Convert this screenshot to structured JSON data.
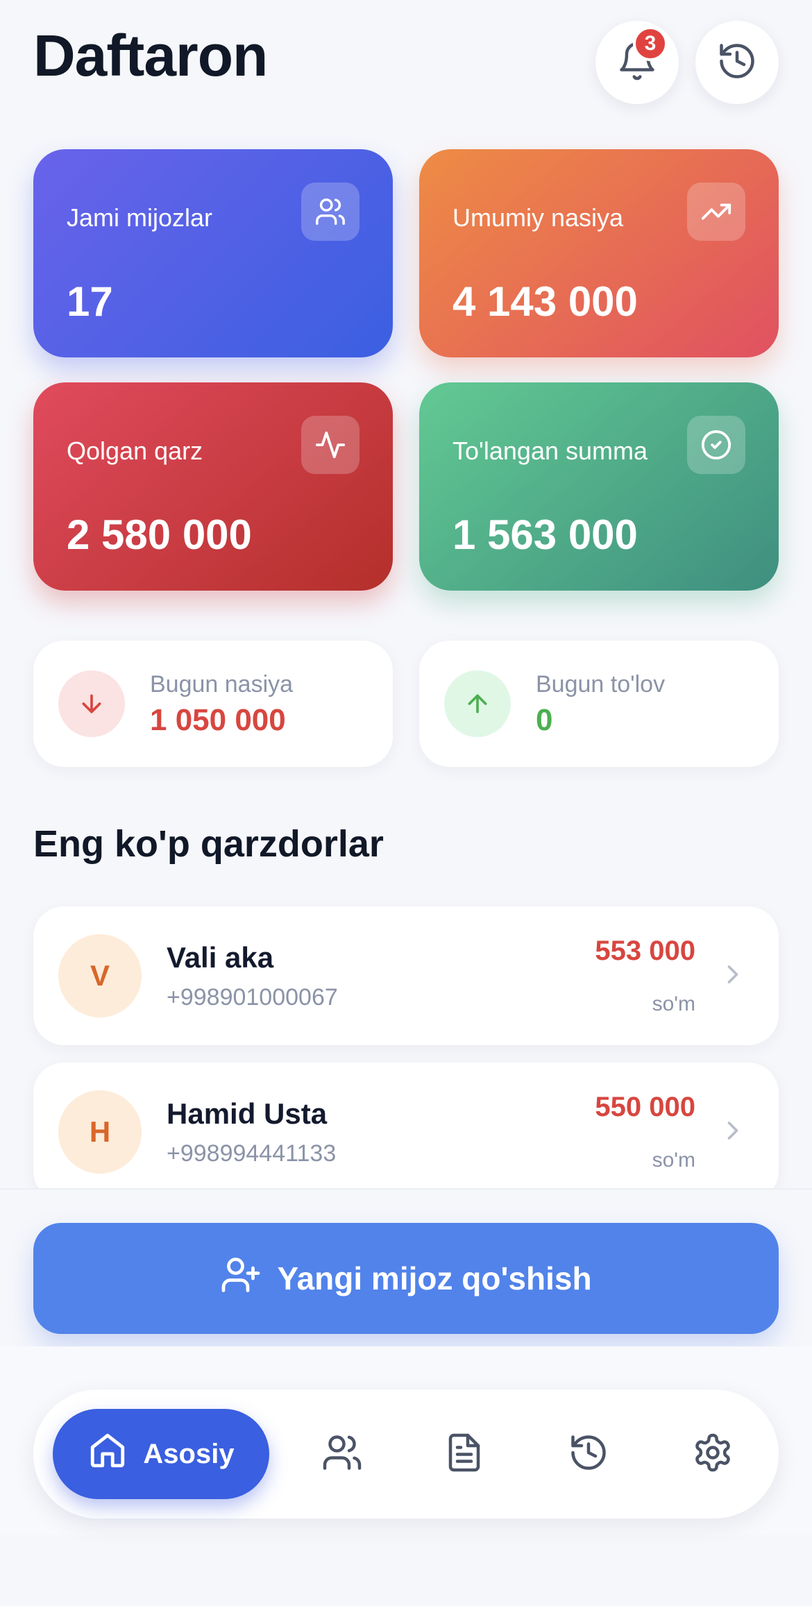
{
  "header": {
    "title": "Daftaron",
    "notification_count": "3"
  },
  "stats": {
    "total_clients": {
      "label": "Jami mijozlar",
      "value": "17"
    },
    "total_credit": {
      "label": "Umumiy nasiya",
      "value": "4 143 000"
    },
    "remaining_debt": {
      "label": "Qolgan qarz",
      "value": "2 580 000"
    },
    "paid_amount": {
      "label": "To'langan summa",
      "value": "1 563 000"
    }
  },
  "today": {
    "credit": {
      "label": "Bugun nasiya",
      "value": "1 050 000"
    },
    "payment": {
      "label": "Bugun to'lov",
      "value": "0"
    }
  },
  "top_debtors": {
    "title": "Eng ko'p qarzdorlar",
    "items": [
      {
        "initial": "V",
        "name": "Vali aka",
        "phone": "+998901000067",
        "amount": "553 000",
        "currency": "so'm"
      },
      {
        "initial": "H",
        "name": "Hamid Usta",
        "phone": "+998994441133",
        "amount": "550 000",
        "currency": "so'm"
      }
    ]
  },
  "actions": {
    "add_client": "Yangi mijoz qo'shish"
  },
  "nav": {
    "home": "Asosiy",
    "icons": [
      "home-icon",
      "users-icon",
      "document-icon",
      "history-icon",
      "settings-icon"
    ]
  },
  "colors": {
    "primary": "#3a5fe0",
    "button": "#5183ea",
    "danger": "#d7463f",
    "success": "#4caf50"
  }
}
